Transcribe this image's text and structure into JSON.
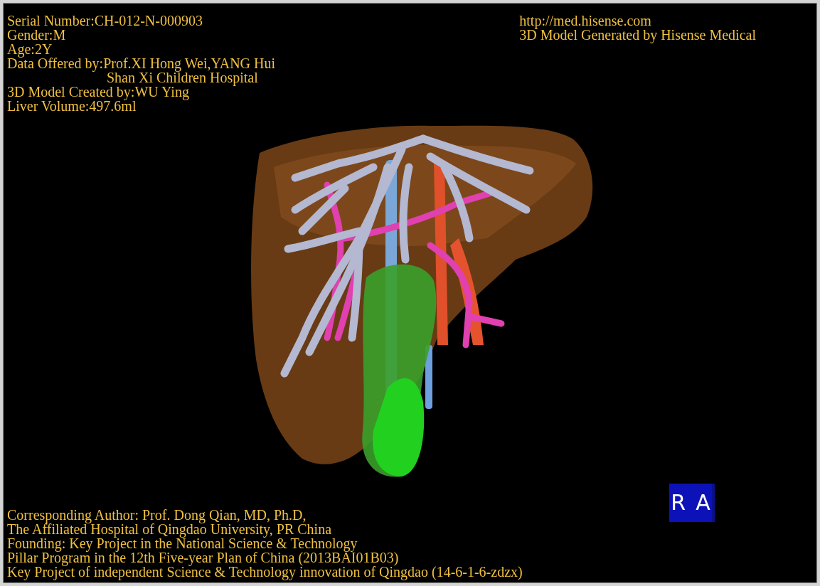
{
  "header_left": [
    {
      "text": "Serial Number:CH-012-N-000903",
      "indent": false
    },
    {
      "text": "Gender:M",
      "indent": false
    },
    {
      "text": "Age:2Y",
      "indent": false
    },
    {
      "text": "Data Offered by:Prof.XI Hong Wei,YANG Hui",
      "indent": false
    },
    {
      "text": "Shan Xi Children Hospital",
      "indent": true
    },
    {
      "text": "3D Model Created by:WU Ying",
      "indent": false
    },
    {
      "text": "Liver Volume:497.6ml",
      "indent": false
    }
  ],
  "header_right": [
    {
      "text": "http://med.hisense.com"
    },
    {
      "text": "3D Model Generated by Hisense Medical"
    }
  ],
  "footer": [
    {
      "text": "Corresponding Author: Prof. Dong Qian, MD, Ph.D,"
    },
    {
      "text": "The Affiliated Hospital of Qingdao University, PR China"
    },
    {
      "text": "Founding: Key Project in the National Science & Technology"
    },
    {
      "text": "Pillar Program in the 12th Five-year Plan of China (2013BAI01B03)"
    },
    {
      "text": "Key Project of independent Science & Technology innovation of Qingdao (14-6-1-6-zdzx)"
    }
  ],
  "orientation_cube": {
    "labels": [
      "R",
      "A"
    ]
  }
}
